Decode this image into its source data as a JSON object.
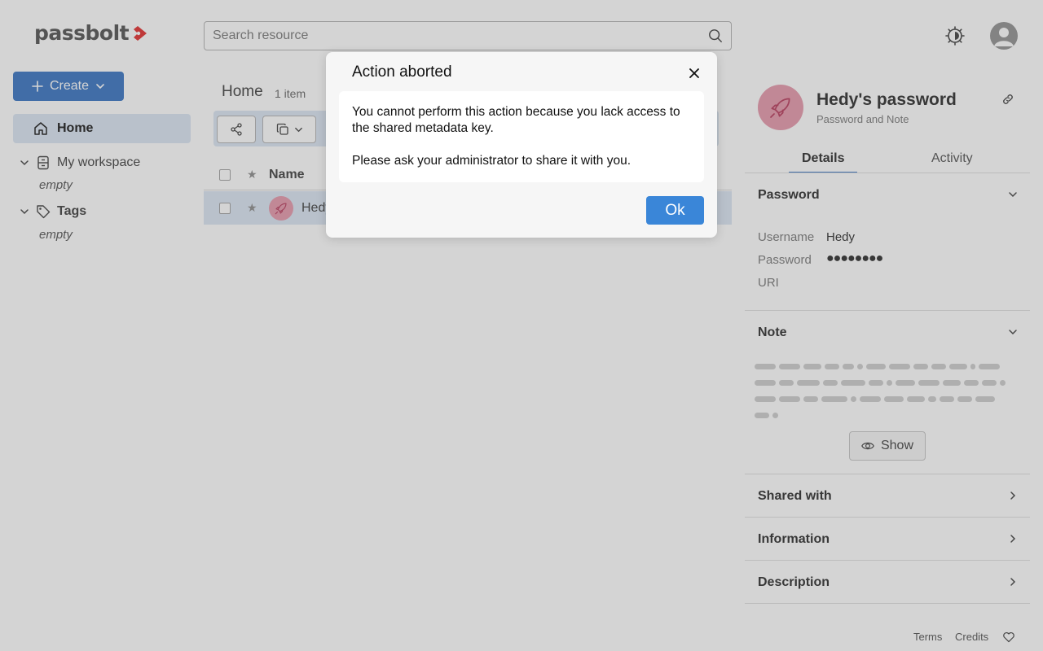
{
  "header": {
    "logo_text": "passbolt",
    "search_placeholder": "Search resource"
  },
  "sidebar": {
    "create_label": "Create",
    "home_label": "Home",
    "workspace_label": "My workspace",
    "workspace_empty": "empty",
    "tags_label": "Tags",
    "tags_empty": "empty"
  },
  "main": {
    "title": "Home",
    "count": "1 item",
    "column_name": "Name",
    "rows": [
      {
        "name": "Hedy"
      }
    ]
  },
  "details": {
    "title": "Hedy's password",
    "subtitle": "Password and Note",
    "tabs": [
      "Details",
      "Activity"
    ],
    "active_tab": "Details",
    "password_section": "Password",
    "fields": [
      {
        "label": "Username",
        "value": "Hedy"
      },
      {
        "label": "Password",
        "value": "●●●●●●●●"
      },
      {
        "label": "URI",
        "value": ""
      }
    ],
    "note_section": "Note",
    "show_label": "Show",
    "sections": [
      "Shared with",
      "Information",
      "Description"
    ]
  },
  "footer": {
    "terms": "Terms",
    "credits": "Credits"
  },
  "dialog": {
    "title": "Action aborted",
    "message_1": "You cannot perform this action because you lack access to the shared metadata key.",
    "message_2": "Please ask your administrator to share it with you.",
    "ok_label": "Ok"
  },
  "colors": {
    "accent": "#3a86d8",
    "brand_red": "#e64545",
    "avatar_pink": "#e8a4b5",
    "selection": "#dfe9f5"
  }
}
